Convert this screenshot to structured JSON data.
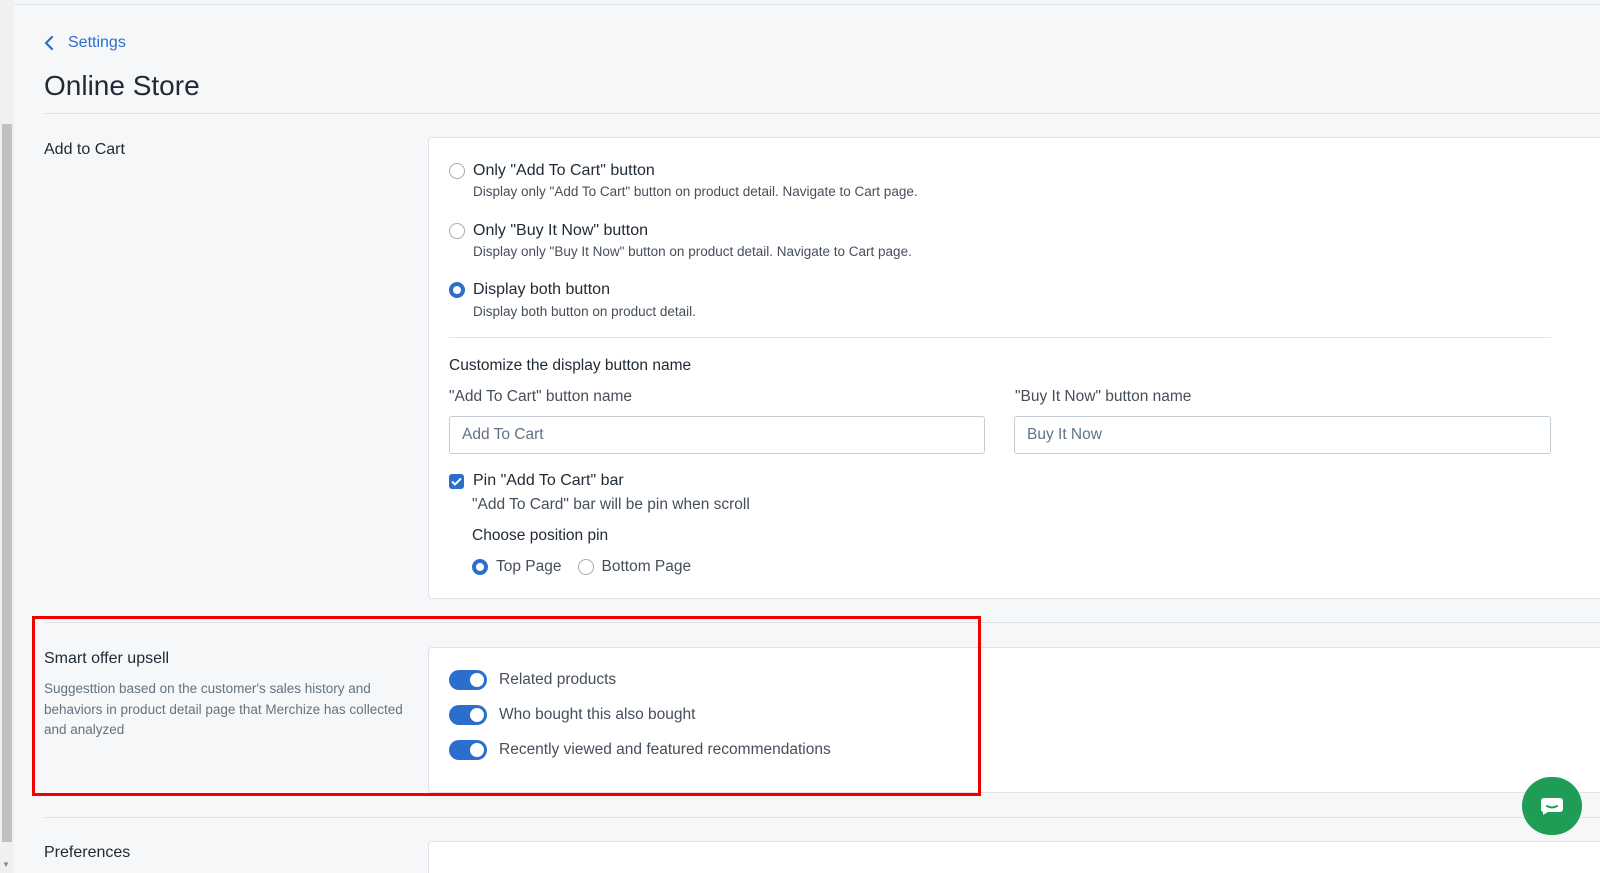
{
  "breadcrumb": {
    "label": "Settings"
  },
  "page": {
    "title": "Online Store"
  },
  "add_to_cart": {
    "section_label": "Add to Cart",
    "options": [
      {
        "title": "Only \"Add To Cart\" button",
        "description": "Display only \"Add To Cart\" button on product detail. Navigate to Cart page.",
        "selected": false
      },
      {
        "title": "Only \"Buy It Now\" button",
        "description": "Display only \"Buy It Now\" button on product detail. Navigate to Cart page.",
        "selected": false
      },
      {
        "title": "Display both button",
        "description": "Display both button on product detail.",
        "selected": true
      }
    ],
    "customize_heading": "Customize the display button name",
    "add_to_cart_field": {
      "label": "\"Add To Cart\" button name",
      "placeholder": "Add To Cart"
    },
    "buy_now_field": {
      "label": "\"Buy It Now\" button name",
      "placeholder": "Buy It Now"
    },
    "pin": {
      "label": "Pin \"Add To Cart\" bar",
      "checked": true,
      "description": "\"Add To Card\" bar will be pin when scroll",
      "position_heading": "Choose position pin",
      "positions": [
        {
          "label": "Top Page",
          "selected": true
        },
        {
          "label": "Bottom Page",
          "selected": false
        }
      ]
    }
  },
  "smart_offer": {
    "section_label": "Smart offer upsell",
    "description": "Suggesttion based on the customer's sales history and behaviors in product detail page that Merchize has collected and analyzed",
    "toggles": [
      {
        "label": "Related products",
        "enabled": true
      },
      {
        "label": "Who bought this also bought",
        "enabled": true
      },
      {
        "label": "Recently viewed and featured recommendations",
        "enabled": true
      }
    ]
  },
  "preferences": {
    "section_label": "Preferences"
  },
  "colors": {
    "accent": "#2c6ecb",
    "highlight": "#f20000",
    "chat": "#1f9c55"
  },
  "icons": {
    "back": "chevron-left-icon",
    "chat": "chat-bubble-icon"
  }
}
